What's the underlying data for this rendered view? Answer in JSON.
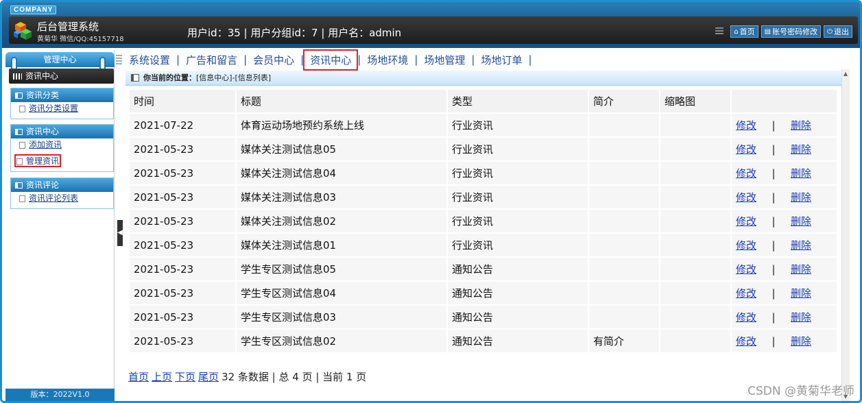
{
  "header": {
    "company": "COMPANY",
    "title": "后台管理系统",
    "subtitle": "黄菊华 微信/QQ:45157718",
    "user_info": "用户id：35 | 用户分组id：7 | 用户名：admin",
    "links": [
      {
        "icon": "home-icon",
        "label": "首页"
      },
      {
        "icon": "settings-icon",
        "label": "账号密码修改"
      },
      {
        "icon": "power-icon",
        "label": "退出"
      }
    ]
  },
  "sidebar": {
    "head": "管理中心",
    "current": "资讯中心",
    "groups": [
      {
        "title": "资讯分类",
        "items": [
          "资讯分类设置"
        ]
      },
      {
        "title": "资讯中心",
        "items": [
          "添加资讯",
          "管理资讯"
        ]
      },
      {
        "title": "资讯评论",
        "items": [
          "资讯评论列表"
        ]
      }
    ],
    "version": "版本：2022V1.0"
  },
  "nav": {
    "items": [
      "系统设置",
      "广告和留言",
      "会员中心",
      "资讯中心",
      "场地环境",
      "场地管理",
      "场地订单"
    ],
    "separator": "|",
    "selected": "资讯中心"
  },
  "breadcrumb": {
    "label": "你当前的位置：",
    "path": "[信息中心]-[信息列表]"
  },
  "table": {
    "columns": [
      "时间",
      "标题",
      "类型",
      "简介",
      "缩略图",
      ""
    ],
    "edit_label": "修改",
    "delete_label": "删除",
    "action_separator": "|",
    "rows": [
      {
        "time": "2021-07-22",
        "title": "体育运动场地预约系统上线",
        "type": "行业资讯",
        "intro": "",
        "thumb": ""
      },
      {
        "time": "2021-05-23",
        "title": "媒体关注测试信息05",
        "type": "行业资讯",
        "intro": "",
        "thumb": ""
      },
      {
        "time": "2021-05-23",
        "title": "媒体关注测试信息04",
        "type": "行业资讯",
        "intro": "",
        "thumb": ""
      },
      {
        "time": "2021-05-23",
        "title": "媒体关注测试信息03",
        "type": "行业资讯",
        "intro": "",
        "thumb": ""
      },
      {
        "time": "2021-05-23",
        "title": "媒体关注测试信息02",
        "type": "行业资讯",
        "intro": "",
        "thumb": ""
      },
      {
        "time": "2021-05-23",
        "title": "媒体关注测试信息01",
        "type": "行业资讯",
        "intro": "",
        "thumb": ""
      },
      {
        "time": "2021-05-23",
        "title": "学生专区测试信息05",
        "type": "通知公告",
        "intro": "",
        "thumb": ""
      },
      {
        "time": "2021-05-23",
        "title": "学生专区测试信息04",
        "type": "通知公告",
        "intro": "",
        "thumb": ""
      },
      {
        "time": "2021-05-23",
        "title": "学生专区测试信息03",
        "type": "通知公告",
        "intro": "",
        "thumb": ""
      },
      {
        "time": "2021-05-23",
        "title": "学生专区测试信息02",
        "type": "通知公告",
        "intro": "有简介",
        "thumb": ""
      }
    ]
  },
  "pager": {
    "first": "首页",
    "prev": "上页",
    "next": "下页",
    "last": "尾页",
    "summary": "32 条数据 | 总 4 页 | 当前 1 页"
  },
  "watermark": "CSDN @黄菊华老师",
  "colors": {
    "accent": "#1b78b8",
    "highlight": "#e02020",
    "link": "#1a3bb8"
  }
}
